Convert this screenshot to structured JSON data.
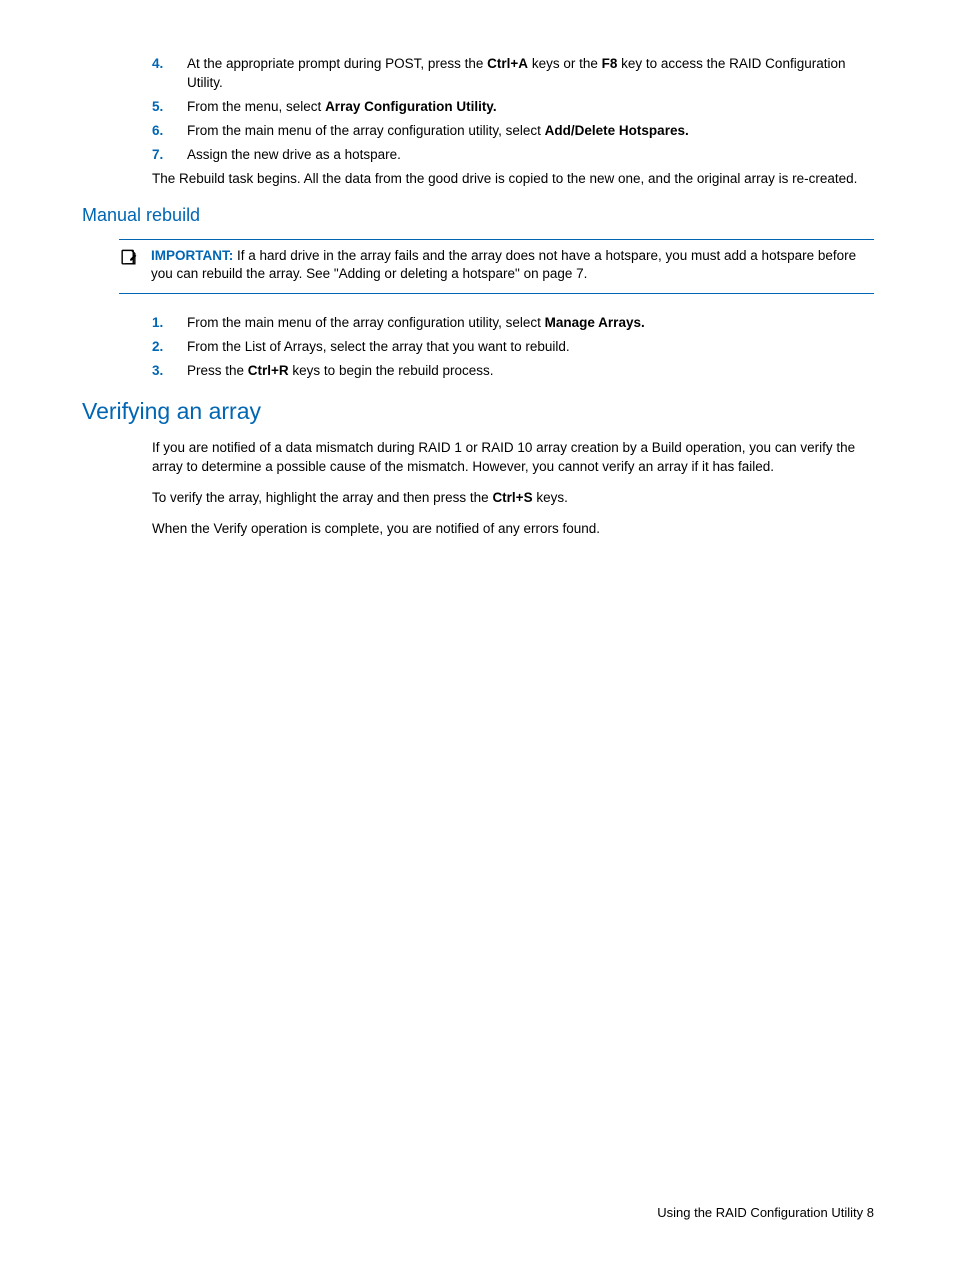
{
  "steps1": [
    {
      "num": "4.",
      "pre": "At the appropriate prompt during POST, press the ",
      "b1": "Ctrl+A",
      "mid": " keys or the ",
      "b2": "F8",
      "post": " key to access the RAID Configuration Utility."
    },
    {
      "num": "5.",
      "pre": "From the menu, select ",
      "b1": "Array Configuration Utility.",
      "mid": "",
      "b2": "",
      "post": ""
    },
    {
      "num": "6.",
      "pre": "From the main menu of the array configuration utility, select ",
      "b1": "Add/Delete Hotspares.",
      "mid": "",
      "b2": "",
      "post": ""
    },
    {
      "num": "7.",
      "pre": "Assign the new drive as a hotspare.",
      "b1": "",
      "mid": "",
      "b2": "",
      "post": ""
    }
  ],
  "rebuild_para": "The Rebuild task begins. All the data from the good drive is copied to the new one, and the original array is re-created.",
  "manual_rebuild_heading": "Manual rebuild",
  "important_label": "IMPORTANT:",
  "important_text": "  If a hard drive in the array fails and the array does not have a hotspare, you must add a hotspare before you can rebuild the array. See \"Adding or deleting a hotspare\" on page 7.",
  "steps2": [
    {
      "num": "1.",
      "pre": "From the main menu of the array configuration utility, select ",
      "b1": "Manage Arrays.",
      "mid": "",
      "b2": "",
      "post": ""
    },
    {
      "num": "2.",
      "pre": "From the List of Arrays, select the array that you want to rebuild.",
      "b1": "",
      "mid": "",
      "b2": "",
      "post": ""
    },
    {
      "num": "3.",
      "pre": "Press the ",
      "b1": "Ctrl+R",
      "mid": " keys to begin the rebuild process.",
      "b2": "",
      "post": ""
    }
  ],
  "verifying_heading": "Verifying an array",
  "verifying_p1": "If you are notified of a data mismatch during RAID 1 or RAID 10 array creation by a Build operation, you can verify the array to determine a possible cause of the mismatch. However, you cannot verify an array if it has failed.",
  "verifying_p2_pre": "To verify the array, highlight the array and then press the ",
  "verifying_p2_bold": "Ctrl+S",
  "verifying_p2_post": " keys.",
  "verifying_p3": "When the Verify operation is complete, you are notified of any errors found.",
  "footer_text": "Using the RAID Configuration Utility   8"
}
